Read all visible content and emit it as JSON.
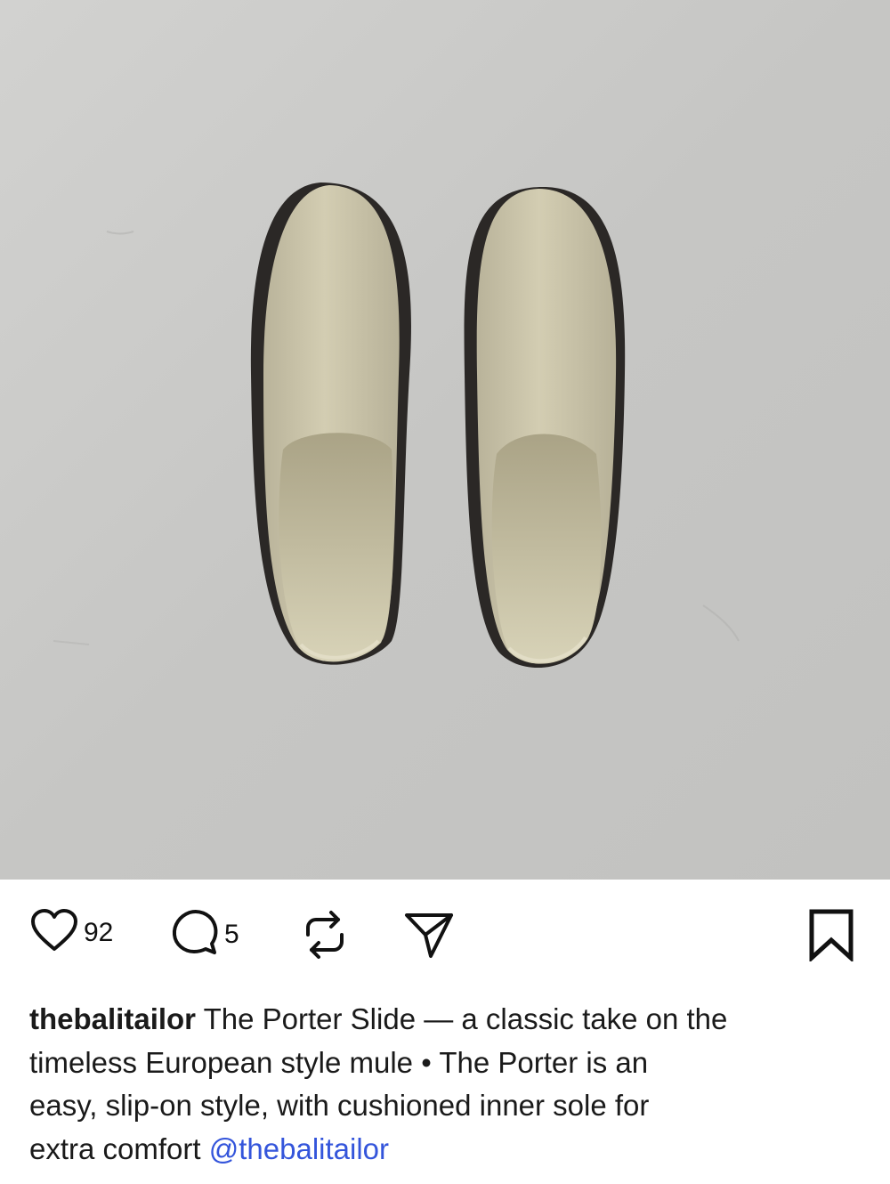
{
  "post": {
    "image": {
      "subject": "pair-of-shoes-photo",
      "colors": {
        "background": "#c9c9c7",
        "shoe": "#cbc5a9",
        "sole": "#2b2826"
      }
    },
    "actions": {
      "likes": "92",
      "comments": "5"
    },
    "caption": {
      "username": "thebalitailor",
      "line1_rest": "The Porter Slide — a classic take on the",
      "line2": "timeless European style mule • The Porter is an",
      "line3": "easy, slip-on style, with cushioned inner sole for",
      "line4_text": "extra comfort",
      "mention": "@thebalitailor"
    },
    "icons": {
      "like": "heart-icon",
      "comment": "comment-bubble-icon",
      "repost": "repost-icon",
      "share": "send-icon",
      "save": "bookmark-icon"
    },
    "colors": {
      "text": "#1a1a1a",
      "mention": "#3455db"
    }
  }
}
